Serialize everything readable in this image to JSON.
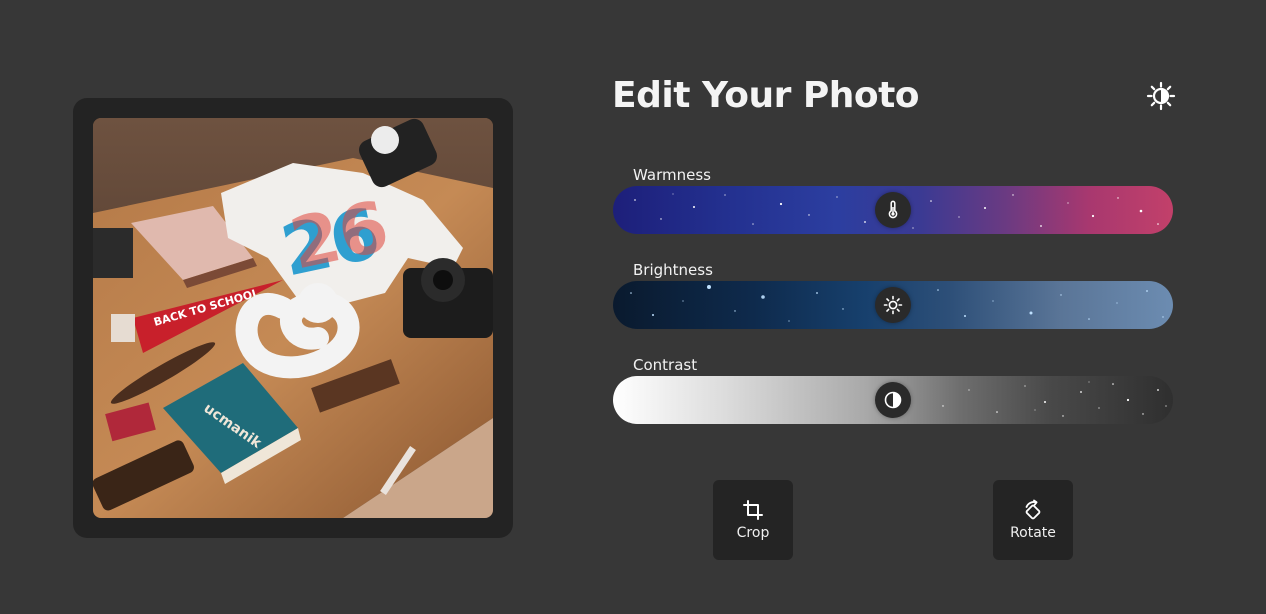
{
  "header": {
    "title": "Edit Your Photo",
    "theme_toggle_icon": "brightness-contrast-icon"
  },
  "photo": {
    "icon": "photo-image",
    "shown_text": {
      "pennant": "BACK TO SCHOOL",
      "book_cover": "ucmanik"
    }
  },
  "controls": [
    {
      "id": "warmness",
      "label": "Warmness",
      "icon": "thermometer-icon",
      "value_percent": 50,
      "track_colors": [
        "#1d1f7a",
        "#c2406a"
      ]
    },
    {
      "id": "brightness",
      "label": "Brightness",
      "icon": "sun-icon",
      "value_percent": 50,
      "track_colors": [
        "#0a1a2e",
        "#6c8cb1"
      ]
    },
    {
      "id": "contrast",
      "label": "Contrast",
      "icon": "half-circle-icon",
      "value_percent": 50,
      "track_colors": [
        "#ffffff",
        "#2f2f2f"
      ]
    }
  ],
  "actions": {
    "crop": {
      "label": "Crop",
      "icon": "crop-icon"
    },
    "rotate": {
      "label": "Rotate",
      "icon": "rotate-icon"
    }
  },
  "colors": {
    "background": "#373737",
    "panel": "#232323",
    "button": "#242424",
    "thumb": "#2a2a2a",
    "text": "#ffffff"
  }
}
